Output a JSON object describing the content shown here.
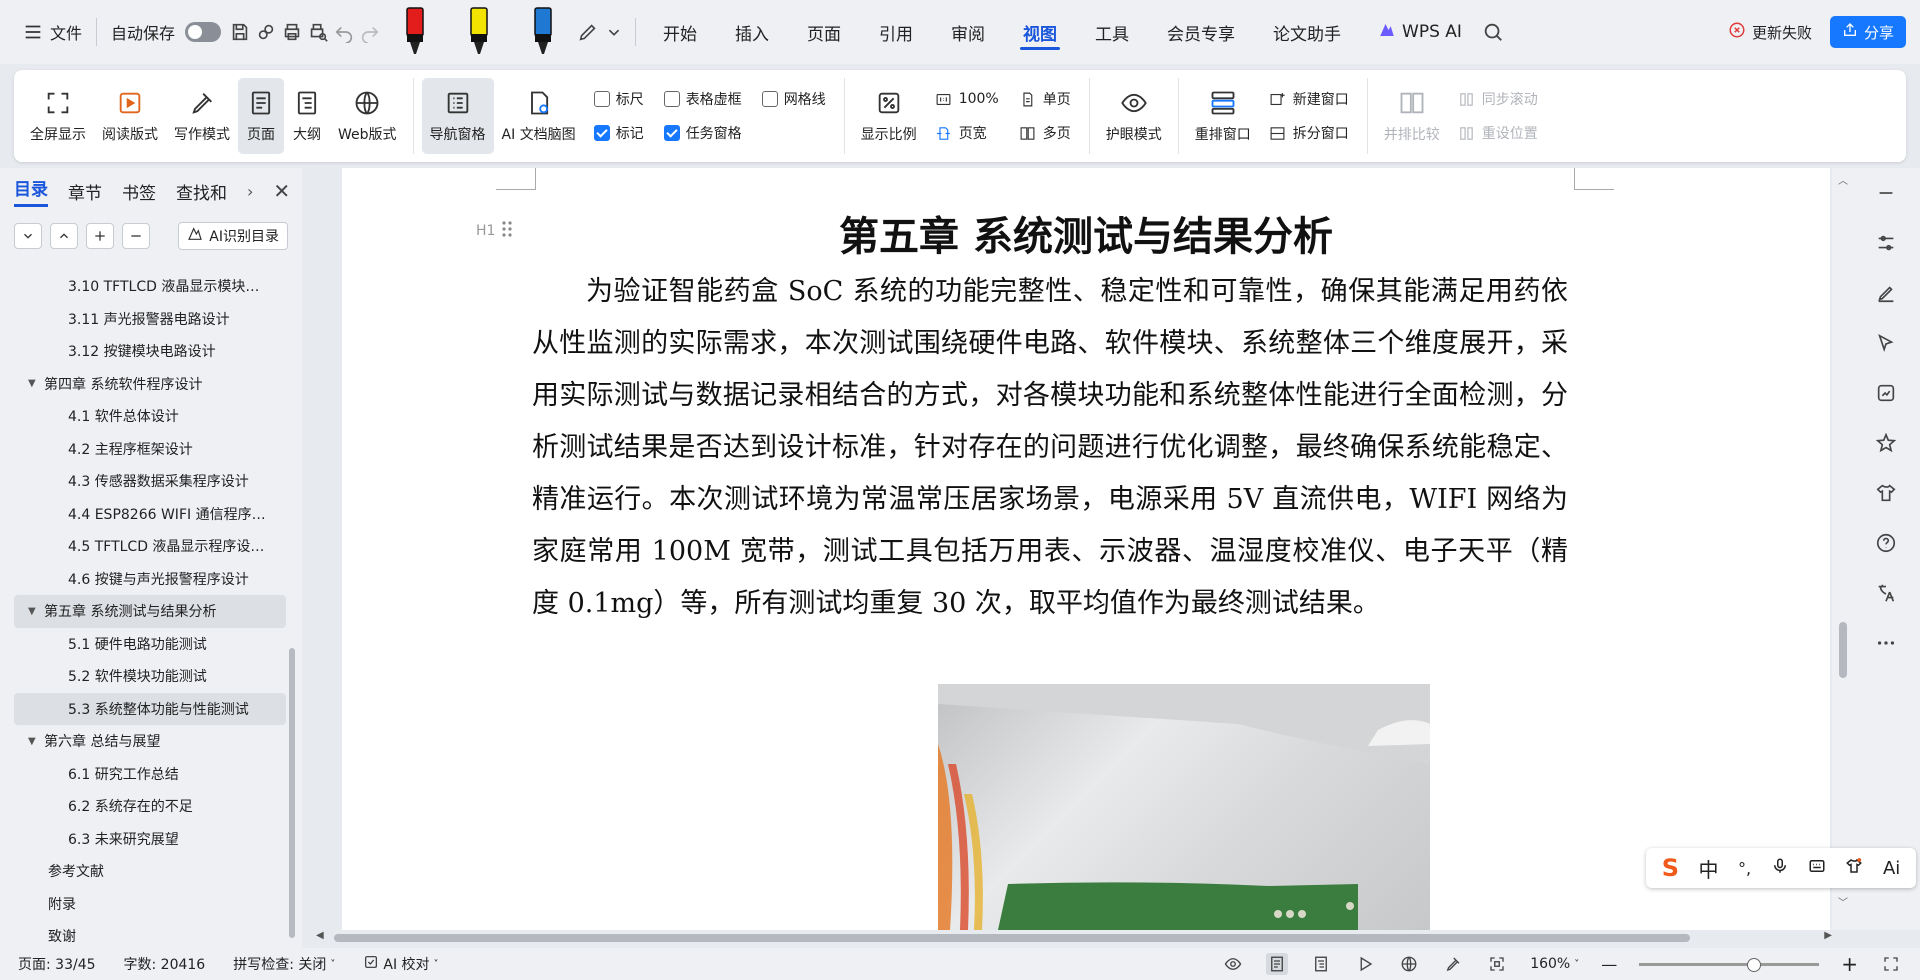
{
  "topbar": {
    "file_label": "文件",
    "autosave_label": "自动保存",
    "menu_tabs": [
      "开始",
      "插入",
      "页面",
      "引用",
      "审阅",
      "视图",
      "工具",
      "会员专享",
      "论文助手"
    ],
    "active_tab": "视图",
    "wps_ai_label": "WPS AI",
    "update_label": "更新失败",
    "share_label": "分享",
    "pen_colors": [
      "#e31c1c",
      "#f2e400",
      "#1f78d1"
    ]
  },
  "ribbon": {
    "fullscreen": "全屏显示",
    "reading": "阅读版式",
    "writing": "写作模式",
    "page": "页面",
    "outline": "大纲",
    "web": "Web版式",
    "nav_pane": "导航窗格",
    "ai_mindmap": "AI 文档脑图",
    "ruler": "标尺",
    "table_gridlines": "表格虚框",
    "gridlines": "网格线",
    "marks": "标记",
    "task_pane": "任务窗格",
    "zoom_ratio": "显示比例",
    "zoom_100": "100%",
    "page_width": "页宽",
    "single_page": "单页",
    "multi_page": "多页",
    "eye_care": "护眼模式",
    "rearrange": "重排窗口",
    "new_window": "新建窗口",
    "split_window": "拆分窗口",
    "side_by_side": "并排比较",
    "sync_scroll": "同步滚动",
    "reset_pos": "重设位置"
  },
  "nav": {
    "tabs": [
      "目录",
      "章节",
      "书签",
      "查找和"
    ],
    "active_tab": "目录",
    "ai_toc": "AI识别目录",
    "items": [
      {
        "level": 2,
        "text": "3.10 TFTLCD 液晶显示模块…"
      },
      {
        "level": 2,
        "text": "3.11 声光报警器电路设计"
      },
      {
        "level": 2,
        "text": "3.12 按键模块电路设计"
      },
      {
        "level": 1,
        "text": "第四章 系统软件程序设计"
      },
      {
        "level": 2,
        "text": "4.1 软件总体设计"
      },
      {
        "level": 2,
        "text": "4.2 主程序框架设计"
      },
      {
        "level": 2,
        "text": "4.3 传感器数据采集程序设计"
      },
      {
        "level": 2,
        "text": "4.4 ESP8266 WIFI 通信程序…"
      },
      {
        "level": 2,
        "text": "4.5 TFTLCD 液晶显示程序设…"
      },
      {
        "level": 2,
        "text": "4.6 按键与声光报警程序设计"
      },
      {
        "level": 1,
        "text": "第五章 系统测试与结果分析",
        "selected": true
      },
      {
        "level": 2,
        "text": "5.1 硬件电路功能测试"
      },
      {
        "level": 2,
        "text": "5.2 软件模块功能测试"
      },
      {
        "level": 2,
        "text": "5.3 系统整体功能与性能测试",
        "selected": true
      },
      {
        "level": 1,
        "text": "第六章 总结与展望"
      },
      {
        "level": 2,
        "text": "6.1 研究工作总结"
      },
      {
        "level": 2,
        "text": "6.2 系统存在的不足"
      },
      {
        "level": 2,
        "text": "6.3 未来研究展望"
      },
      {
        "level": 0,
        "text": "参考文献"
      },
      {
        "level": 0,
        "text": "附录"
      },
      {
        "level": 0,
        "text": "致谢"
      }
    ]
  },
  "document": {
    "title": "第五章 系统测试与结果分析",
    "heading_marker": "H1",
    "paragraph": "为验证智能药盒 SoC 系统的功能完整性、稳定性和可靠性，确保其能满足用药依从性监测的实际需求，本次测试围绕硬件电路、软件模块、系统整体三个维度展开，采用实际测试与数据记录相结合的方式，对各模块功能和系统整体性能进行全面检测，分析测试结果是否达到设计标准，针对存在的问题进行优化调整，最终确保系统能稳定、精准运行。本次测试环境为常温常压居家场景，电源采用 5V 直流供电，WIFI 网络为家庭常用 100M 宽带，测试工具包括万用表、示波器、温湿度校准仪、电子天平（精度 0.1mg）等，所有测试均重复 30 次，取平均值作为最终测试结果。"
  },
  "ime": {
    "logo": "S",
    "mode": "中",
    "punct": "°,",
    "ai": "Ai"
  },
  "status": {
    "page": "页面: 33/45",
    "words": "字数: 20416",
    "spell": "拼写检查: 关闭",
    "ai_proof": "AI 校对",
    "zoom": "160%",
    "minus": "—",
    "plus": "+"
  }
}
